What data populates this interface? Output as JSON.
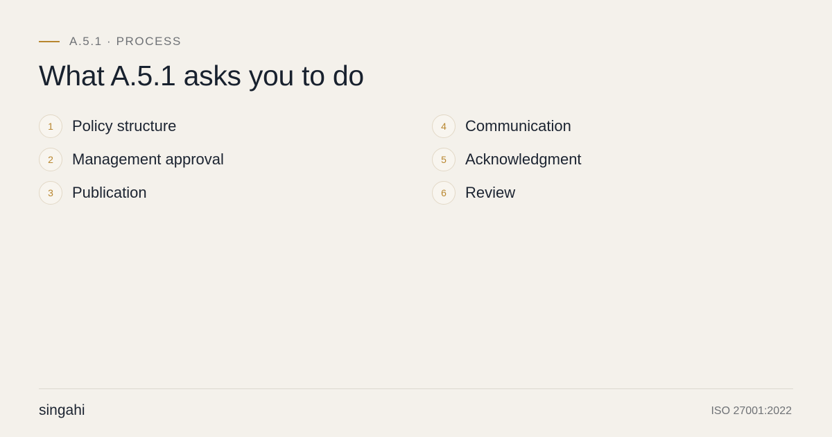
{
  "header": {
    "eyebrow": "A.5.1 · PROCESS",
    "title": "What A.5.1 asks you to do"
  },
  "steps": [
    {
      "number": "1",
      "label": "Policy structure"
    },
    {
      "number": "2",
      "label": "Management approval"
    },
    {
      "number": "3",
      "label": "Publication"
    },
    {
      "number": "4",
      "label": "Communication"
    },
    {
      "number": "5",
      "label": "Acknowledgment"
    },
    {
      "number": "6",
      "label": "Review"
    }
  ],
  "footer": {
    "brand": "singahi",
    "standard": "ISO 27001:2022"
  },
  "colors": {
    "background": "#f4f1eb",
    "accent": "#b8862f",
    "text": "#1b2330",
    "muted": "#6f7276"
  }
}
